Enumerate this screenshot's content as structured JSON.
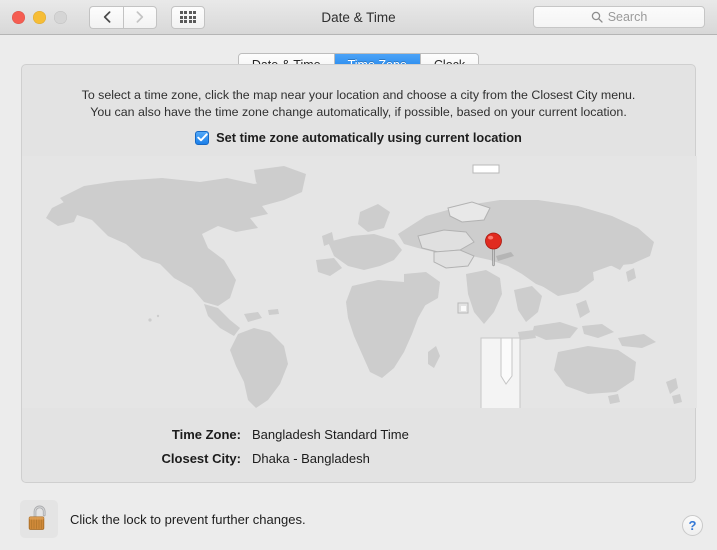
{
  "window": {
    "title": "Date & Time",
    "traffic_lights": [
      {
        "name": "close",
        "color": "#f55d52"
      },
      {
        "name": "minimize",
        "color": "#f6bd36"
      },
      {
        "name": "zoom",
        "color": "#d5d5d5"
      }
    ],
    "nav": {
      "back_icon": "chevron-left-icon",
      "forward_icon": "chevron-right-icon"
    },
    "grid_button_icon": "show-all-preferences-icon"
  },
  "search": {
    "placeholder": "Search",
    "icon": "search-icon"
  },
  "tabs": [
    {
      "label": "Date & Time",
      "active": false
    },
    {
      "label": "Time Zone",
      "active": true
    },
    {
      "label": "Clock",
      "active": false
    }
  ],
  "panel": {
    "description_line1": "To select a time zone, click the map near your location and choose a city from the Closest City menu.",
    "description_line2": "You can also have the time zone change automatically, if possible, based on your current location.",
    "auto_timezone": {
      "label": "Set time zone automatically using current location",
      "checked": true,
      "check_icon": "checkmark-icon"
    },
    "map": {
      "name": "world-time-zone-map",
      "pin_icon": "location-pin-icon",
      "pin_color": "#e02b20",
      "ocean_color": "#e5e5e5",
      "land_color": "#cfcfcf",
      "highlight_band_color": "#f4f4f4"
    },
    "info_rows": [
      {
        "label": "Time Zone:",
        "value": "Bangladesh Standard Time"
      },
      {
        "label": "Closest City:",
        "value": "Dhaka - Bangladesh"
      }
    ]
  },
  "lock": {
    "icon": "unlocked-padlock-icon",
    "text": "Click the lock to prevent further changes."
  },
  "help": {
    "label": "?",
    "icon": "help-icon"
  }
}
